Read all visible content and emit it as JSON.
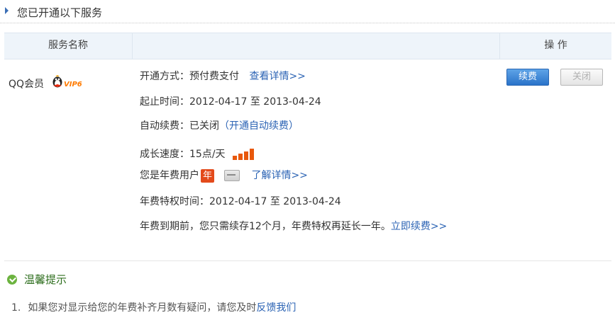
{
  "header": {
    "title": "您已开通以下服务"
  },
  "table": {
    "col_service_name": "服务名称",
    "col_operations": "操 作"
  },
  "service": {
    "name": "QQ会员",
    "vip_badge": "VIP6",
    "open_method_label": "开通方式：",
    "open_method_value": "预付费支付",
    "view_details_link": "查看详情>>",
    "period_label": "起止时间：",
    "period_start": "2012-04-17",
    "period_to": "至",
    "period_end": "2013-04-24",
    "auto_renew_label": "自动续费：",
    "auto_renew_status": "已关闭",
    "auto_renew_open_paren": "（",
    "auto_renew_link": "开通自动续费",
    "auto_renew_close_paren": "）",
    "growth_label": "成长速度：",
    "growth_value": "15点/天",
    "annual_user_text": "您是年费用户",
    "annual_badge": "年",
    "learn_more_link": "了解详情>>",
    "annual_period_label": "年费特权时间：",
    "annual_start": "2012-04-17",
    "annual_to": "至",
    "annual_end": "2013-04-24",
    "promo_text": "年费到期前，您只需续存12个月，年费特权再延长一年。",
    "renew_now_link": "立即续费>>"
  },
  "buttons": {
    "renew": "续费",
    "close": "关闭"
  },
  "tips": {
    "title": "温馨提示",
    "items": [
      {
        "num": "1.",
        "text": "如果您对显示给您的年费补齐月数有疑问，请您及时",
        "link": "反馈我们"
      }
    ]
  },
  "colors": {
    "accent": "#2b63b4",
    "button_blue": "#2a73c9",
    "header_bg": "#eef4fa",
    "tips_green": "#6cb33f"
  }
}
